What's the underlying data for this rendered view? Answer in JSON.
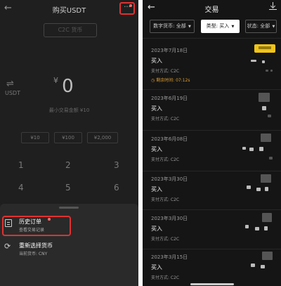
{
  "left": {
    "title": "购买USDT",
    "c2c_label": "C2C 货币",
    "currency": "USDT",
    "amount_symbol": "¥",
    "amount_value": "0",
    "min_amount_text": "最小交易金额  ¥10",
    "quick_amounts": [
      "¥10",
      "¥100",
      "¥2,000"
    ],
    "keypad": [
      "1",
      "2",
      "3",
      "4",
      "5",
      "6"
    ],
    "sheet": {
      "history_title": "历史订单",
      "history_sub": "查看交易记录",
      "reselect_title": "重新选择货币",
      "reselect_sub": "当前货币:  CNY"
    },
    "accent_color": "#e03131"
  },
  "right": {
    "title": "交易",
    "filters": [
      {
        "key": "数字货币:",
        "value": "全部"
      },
      {
        "key": "类型:",
        "value": "买入"
      },
      {
        "key": "状态:",
        "value": "全部"
      }
    ],
    "orders": [
      {
        "date": "2023年7月18日",
        "side": "买入",
        "pay": "支付方式:  C2C",
        "remain": "剩余时间:  07:12s"
      },
      {
        "date": "2023年6月19日",
        "side": "买入",
        "pay": "支付方式:  C2C"
      },
      {
        "date": "2023年6月08日",
        "side": "买入",
        "pay": "支付方式:  C2C"
      },
      {
        "date": "2023年3月30日",
        "side": "买入",
        "pay": "支付方式:  C2C"
      },
      {
        "date": "2023年3月30日",
        "side": "买入",
        "pay": "支付方式:  C2C"
      },
      {
        "date": "2023年3月15日",
        "side": "买入",
        "pay": "支付方式:  C2C"
      }
    ],
    "pending_color": "#e0a032"
  }
}
